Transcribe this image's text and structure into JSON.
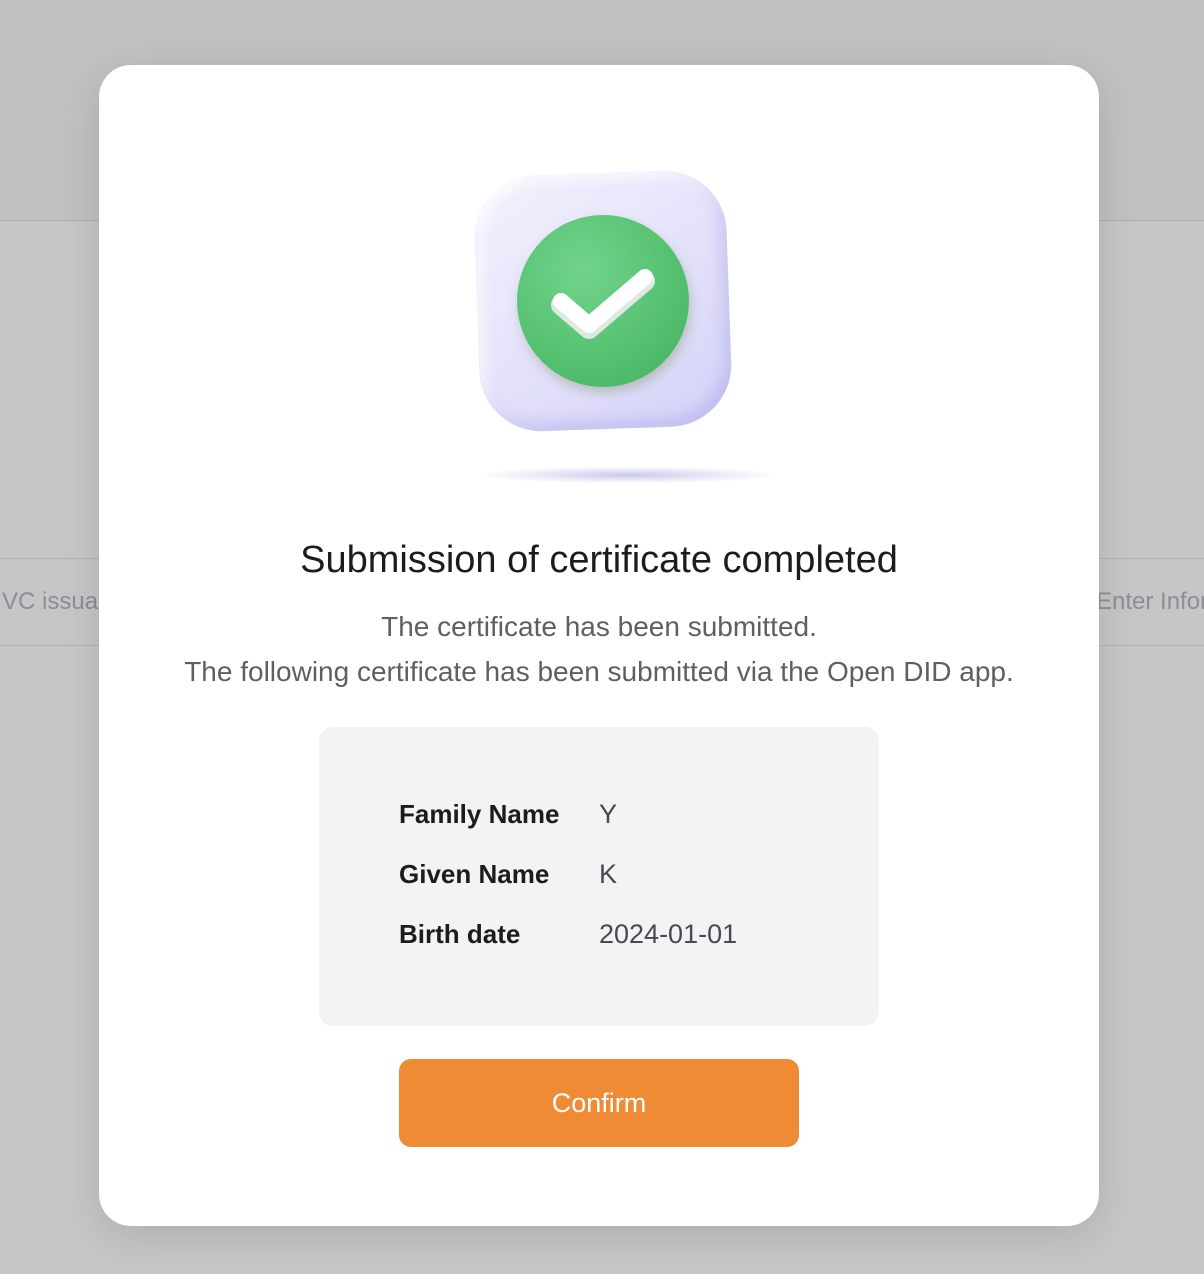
{
  "background": {
    "left_row_text": "VC issua",
    "right_row_text": "Enter Infor"
  },
  "modal": {
    "icon": "success-check-icon",
    "title": "Submission of certificate completed",
    "description_line1": "The certificate has been submitted.",
    "description_line2": "The following certificate has been submitted via the Open DID app.",
    "fields": [
      {
        "label": "Family Name",
        "value": "Y"
      },
      {
        "label": "Given Name",
        "value": "K"
      },
      {
        "label": "Birth date",
        "value": "2024-01-01"
      }
    ],
    "confirm_label": "Confirm"
  },
  "colors": {
    "accent": "#ef8b35",
    "success": "#56c271",
    "tile": "#e5e4fb"
  }
}
